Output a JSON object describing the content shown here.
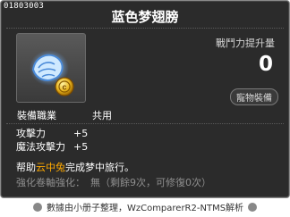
{
  "item": {
    "id": "01803003",
    "name": "蓝色梦翅膀",
    "icon": "blue-dream-wings-with-gold-coin-icon"
  },
  "power": {
    "label": "戰鬥力提升量",
    "value": "0"
  },
  "pet_equip": "寵物裝備",
  "job": {
    "label": "裝備職業",
    "value": "共用"
  },
  "stats": [
    {
      "name": "攻擊力",
      "value": "+5"
    },
    {
      "name": "魔法攻擊力",
      "value": "+5"
    }
  ],
  "description": {
    "prefix": "帮助",
    "highlight": "云中兔",
    "suffix": "完成梦中旅行。"
  },
  "enhance": {
    "label": "強化卷軸強化：",
    "value": "無",
    "detail": "（剩餘9次，可修復0次）"
  },
  "footer": {
    "text": "數據由小册子整理，WzComparerR2-NTMS解析"
  },
  "colors": {
    "background": "#2b2b2b",
    "highlight": "#ffaa00",
    "muted": "#8f8f8f"
  }
}
